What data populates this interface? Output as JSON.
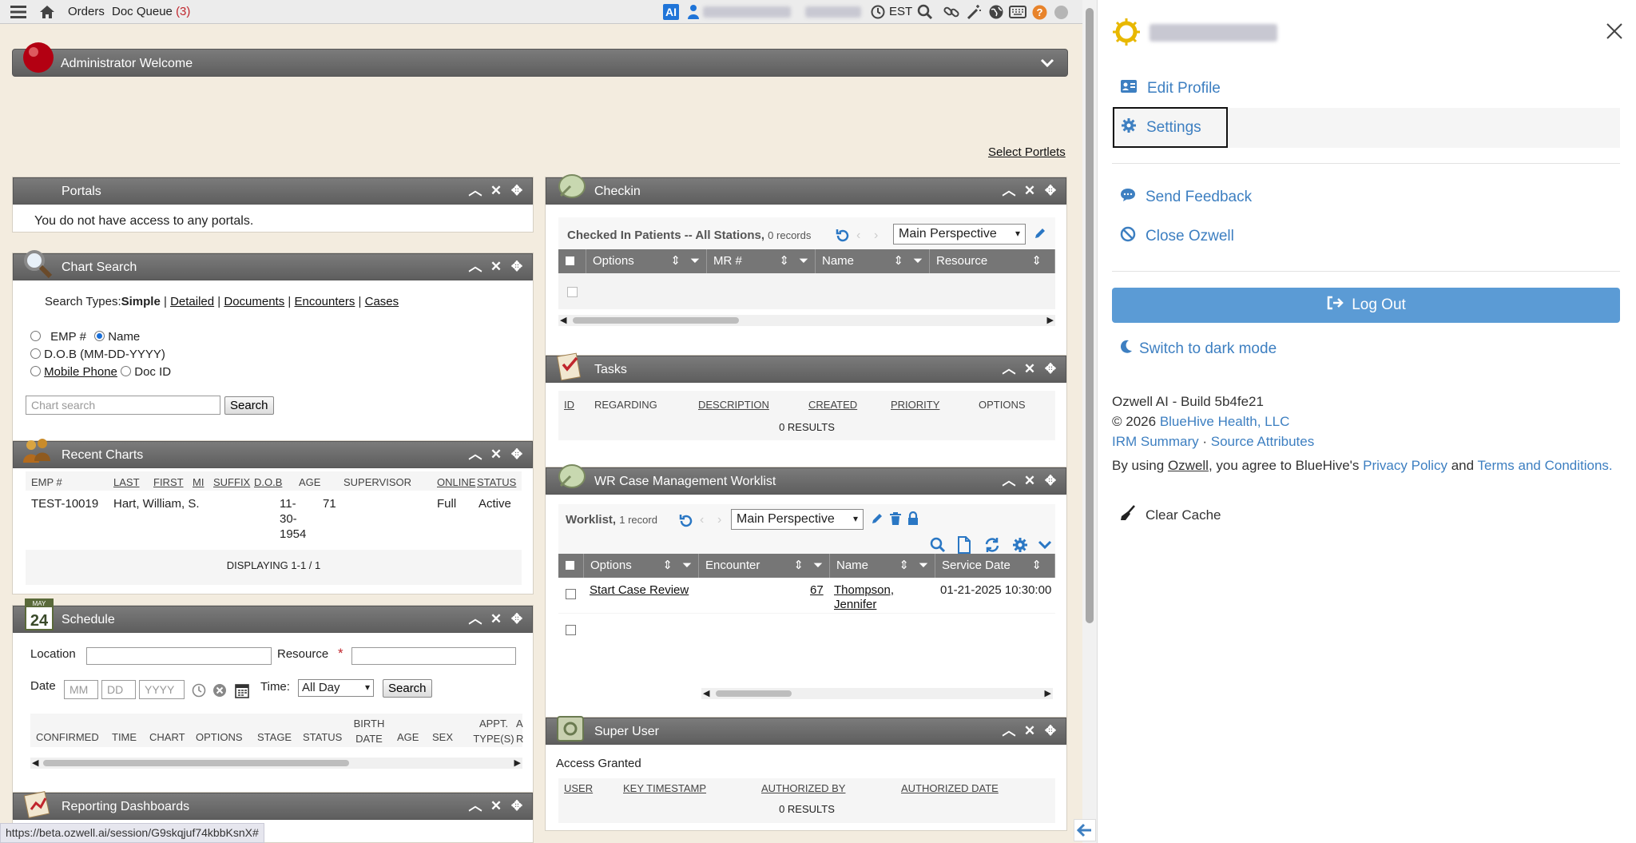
{
  "topbar": {
    "orders": "Orders",
    "doc_queue": "Doc Queue",
    "doc_queue_count": "(3)",
    "ai_badge": "AI",
    "timezone": "EST"
  },
  "welcome": {
    "title": "Administrator Welcome"
  },
  "select_portlets": "Select Portlets",
  "portals": {
    "title": "Portals",
    "message": "You do not have access to any portals."
  },
  "chart_search": {
    "title": "Chart Search",
    "search_types_label": "Search Types:",
    "types": [
      "Simple",
      "Detailed",
      "Documents",
      "Encounters",
      "Cases"
    ],
    "separator": "|",
    "options": {
      "emp": "EMP #",
      "name": "Name",
      "dob": "D.O.B (MM-DD-YYYY)",
      "mobile": "Mobile Phone",
      "docid": "Doc ID"
    },
    "placeholder": "Chart search",
    "button": "Search"
  },
  "recent_charts": {
    "title": "Recent Charts",
    "columns": [
      "EMP #",
      "LAST",
      "FIRST",
      "MI",
      "SUFFIX",
      "D.O.B",
      "AGE",
      "SUPERVISOR",
      "ONLINE",
      "STATUS"
    ],
    "row": {
      "emp": "TEST-10019",
      "name": "Hart, William, S.",
      "dob1": "11-",
      "dob2": "30-",
      "dob3": "1954",
      "age": "71",
      "online": "Full",
      "status": "Active"
    },
    "footer": "DISPLAYING 1-1 / 1"
  },
  "schedule": {
    "title": "Schedule",
    "cal_month": "MAY",
    "cal_day": "24",
    "location_label": "Location",
    "resource_label": "Resource",
    "required": "*",
    "date_label": "Date",
    "mm": "MM",
    "dd": "DD",
    "yyyy": "YYYY",
    "time_label": "Time:",
    "time_value": "All Day",
    "search_button": "Search",
    "columns": [
      "CONFIRMED",
      "TIME",
      "CHART",
      "OPTIONS",
      "STAGE",
      "STATUS",
      "BIRTH DATE",
      "AGE",
      "SEX",
      "APPT. TYPE(S)",
      "A R"
    ]
  },
  "reporting": {
    "title": "Reporting Dashboards"
  },
  "checkin": {
    "title": "Checkin",
    "sub_title": "Checked In Patients -- All Stations,",
    "records": "0 records",
    "perspective": "Main Perspective",
    "columns": [
      "Options",
      "MR #",
      "Name",
      "Resource"
    ]
  },
  "tasks": {
    "title": "Tasks",
    "columns": [
      "ID",
      "REGARDING",
      "DESCRIPTION",
      "CREATED",
      "PRIORITY",
      "OPTIONS"
    ],
    "results": "0 RESULTS"
  },
  "wr_case": {
    "title": "WR Case Management Worklist",
    "worklist_label": "Worklist,",
    "records": "1 record",
    "perspective": "Main Perspective",
    "columns": [
      "Options",
      "Encounter",
      "Name",
      "Service Date"
    ],
    "row": {
      "option": "Start Case Review",
      "encounter": "67",
      "name1": "Thompson,",
      "name2": "Jennifer",
      "date": "01-21-2025 10:30:00"
    }
  },
  "super_user": {
    "title": "Super User",
    "access": "Access Granted",
    "columns": [
      "USER",
      "KEY TIMESTAMP",
      "AUTHORIZED BY",
      "AUTHORIZED DATE"
    ],
    "results": "0 RESULTS"
  },
  "status_url": "https://beta.ozwell.ai/session/G9skqjuf74kbbKsnX#",
  "overlay": {
    "edit_profile": "Edit Profile",
    "settings": "Settings",
    "send_feedback": "Send Feedback",
    "close_ozwell": "Close Ozwell",
    "log_out": "Log Out",
    "dark_mode": "Switch to dark mode",
    "build": "Ozwell AI - Build 5b4fe21",
    "copyright_prefix": "© 2026",
    "company": "BlueHive Health, LLC",
    "irm_summary": "IRM Summary",
    "dot": "·",
    "source_attributes": "Source Attributes",
    "agree_prefix": "By using",
    "ozwell": "Ozwell",
    "agree_mid": ", you agree to BlueHive's",
    "privacy": "Privacy Policy",
    "and": "and",
    "terms": "Terms and Conditions.",
    "clear_cache": "Clear Cache"
  },
  "colors": {
    "accent": "#5b9bd5",
    "link": "#3d7fc1",
    "header": "#6b6b6b"
  }
}
